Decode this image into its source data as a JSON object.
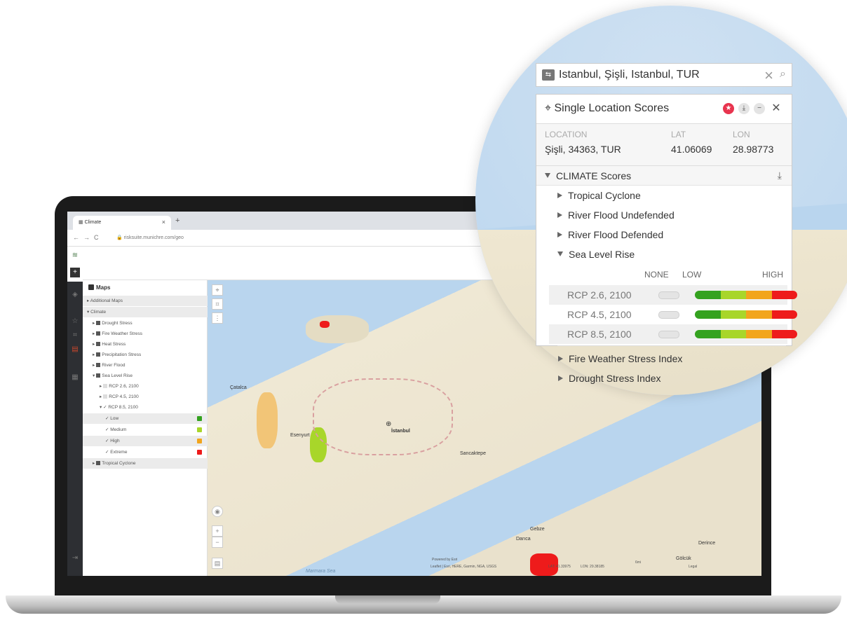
{
  "browser": {
    "tab_title": "Climate",
    "tab_close": "×",
    "new_tab": "+",
    "url": "risksuite.munichre.com/geo"
  },
  "maps_panel": {
    "title": "Maps",
    "rows": [
      {
        "label": "Additional Maps"
      },
      {
        "label": "Climate"
      },
      {
        "label": "Drought Stress"
      },
      {
        "label": "Fire Weather Stress"
      },
      {
        "label": "Heat Stress"
      },
      {
        "label": "Precipitation Stress"
      },
      {
        "label": "River Flood"
      },
      {
        "label": "Sea Level Rise"
      },
      {
        "label": "RCP 2.6, 2100"
      },
      {
        "label": "RCP 4.5, 2100"
      },
      {
        "label": "RCP 8.5, 2100"
      },
      {
        "label": "Low",
        "color": "#34a21f"
      },
      {
        "label": "Medium",
        "color": "#a8d62a"
      },
      {
        "label": "High",
        "color": "#f2a51c"
      },
      {
        "label": "Extreme",
        "color": "#ee1b1b"
      },
      {
        "label": "Tropical Cyclone"
      }
    ]
  },
  "map": {
    "labels": {
      "catalca": "Çatalca",
      "esenyurt": "Esenyurt",
      "istanbul": "İstanbul",
      "sancaktepe": "Sancaktepe",
      "gebze": "Gebze",
      "darica": "Darıca",
      "derince": "Derince",
      "golcuk": "Gölcük",
      "sea": "Marmara Sea"
    },
    "footer": {
      "powered": "Powered by Esri",
      "attribution": "Leaflet | Esri, HERE, Garmin, NGA, USGS",
      "lat": "LAT: 41.33975",
      "lon": "LON: 29.38185",
      "scale": "6mi",
      "legal": "Legal"
    }
  },
  "popup": {
    "search_value": "Istanbul, Şişli, Istanbul, TUR",
    "search_clear": "×",
    "title": "Single Location Scores",
    "location_label": "LOCATION",
    "location_value": "Şişli, 34363, TUR",
    "lat_label": "LAT",
    "lat_value": "41.06069",
    "lon_label": "LON",
    "lon_value": "28.98773",
    "section": "CLIMATE Scores",
    "items": [
      "Tropical Cyclone",
      "River Flood Undefended",
      "River Flood Defended",
      "Sea Level Rise"
    ],
    "scale": {
      "none": "NONE",
      "low": "LOW",
      "high": "HIGH"
    },
    "rcp_rows": [
      "RCP 2.6, 2100",
      "RCP 4.5, 2100",
      "RCP 8.5, 2100"
    ],
    "after_items": [
      "Fire Weather Stress Index",
      "Drought Stress Index"
    ],
    "colors": {
      "low": "#34a21f",
      "medium": "#a8d62a",
      "high": "#f2a51c",
      "extreme": "#ee1b1b",
      "favorite": "#e8344e"
    }
  }
}
